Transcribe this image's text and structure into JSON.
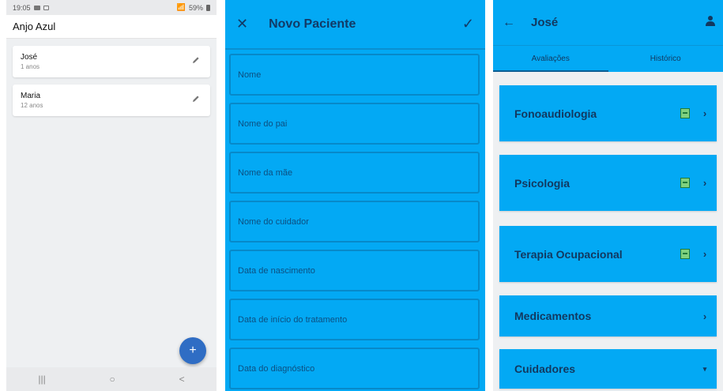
{
  "screen1": {
    "status": {
      "time": "19:05",
      "battery": "59%"
    },
    "app_title": "Anjo Azul",
    "patients": [
      {
        "name": "José",
        "age": "1 anos"
      },
      {
        "name": "Maria",
        "age": "12 anos"
      }
    ],
    "fab_label": "+",
    "nav": {
      "recents": "|||",
      "home": "○",
      "back": "<"
    }
  },
  "screen2": {
    "title": "Novo Paciente",
    "close_glyph": "✕",
    "confirm_glyph": "✓",
    "fields": [
      "Nome",
      "Nome do pai",
      "Nome da mãe",
      "Nome do cuidador",
      "Data de nascimento",
      "Data de início do tratamento",
      "Data do diagnóstico"
    ]
  },
  "screen3": {
    "title": "José",
    "back_glyph": "←",
    "tabs": [
      "Avaliações",
      "Histórico"
    ],
    "sections": [
      {
        "label": "Fonoaudiologia",
        "icon": "pdf-icon",
        "chevron": "›"
      },
      {
        "label": "Psicologia",
        "icon": "pdf-icon",
        "chevron": "›"
      },
      {
        "label": "Terapia Ocupacional",
        "icon": "pdf-icon",
        "chevron": "›"
      },
      {
        "label": "Medicamentos",
        "chevron": "›"
      },
      {
        "label": "Cuidadores",
        "chevron": "▾"
      }
    ],
    "colors": {
      "primary": "#03a9f4",
      "dark_text": "#12385f"
    }
  }
}
